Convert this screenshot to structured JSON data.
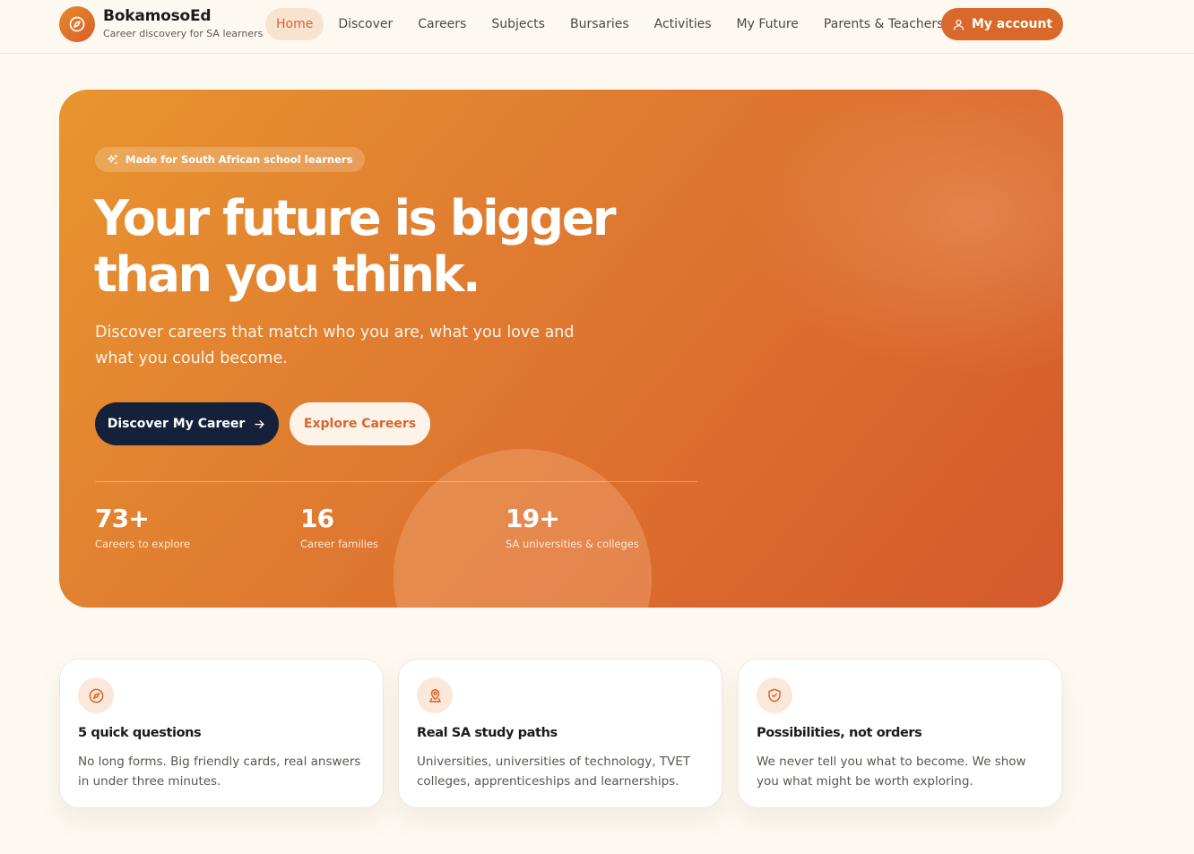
{
  "brand": {
    "name": "BokamosoEd",
    "tagline": "Career discovery for SA learners",
    "logo_icon": "compass-icon"
  },
  "nav": {
    "items": [
      {
        "label": "Home",
        "active": true
      },
      {
        "label": "Discover",
        "active": false
      },
      {
        "label": "Careers",
        "active": false
      },
      {
        "label": "Subjects",
        "active": false
      },
      {
        "label": "Bursaries",
        "active": false
      },
      {
        "label": "Activities",
        "active": false
      },
      {
        "label": "My Future",
        "active": false
      },
      {
        "label": "Parents & Teachers",
        "active": false
      }
    ],
    "account_label": "My account",
    "account_icon": "user-icon"
  },
  "hero": {
    "pill_icon": "sparkles-icon",
    "pill_text": "Made for South African school learners",
    "title_line1": "Your future is bigger",
    "title_line2": "than you think.",
    "subtitle": "Discover careers that match who you are, what you love and what you could become.",
    "primary_cta": "Discover My Career",
    "primary_cta_icon": "arrow-right-icon",
    "secondary_cta": "Explore Careers",
    "stats": [
      {
        "value": "73+",
        "label": "Careers to explore"
      },
      {
        "value": "16",
        "label": "Career families"
      },
      {
        "value": "19+",
        "label": "SA universities & colleges"
      }
    ]
  },
  "features": [
    {
      "icon": "compass-icon",
      "title": "5 quick questions",
      "text": "No long forms. Big friendly cards, real answers in under three minutes."
    },
    {
      "icon": "map-pin-icon",
      "title": "Real SA study paths",
      "text": "Universities, universities of technology, TVET colleges, apprenticeships and learnerships."
    },
    {
      "icon": "shield-check-icon",
      "title": "Possibilities, not orders",
      "text": "We never tell you what to become. We show you what might be worth exploring."
    }
  ],
  "colors": {
    "accent": "#d8692a",
    "hero_start": "#e8952f",
    "hero_end": "#d35a2c",
    "dark_button": "#15213a",
    "page_bg": "#fdf9f1"
  }
}
